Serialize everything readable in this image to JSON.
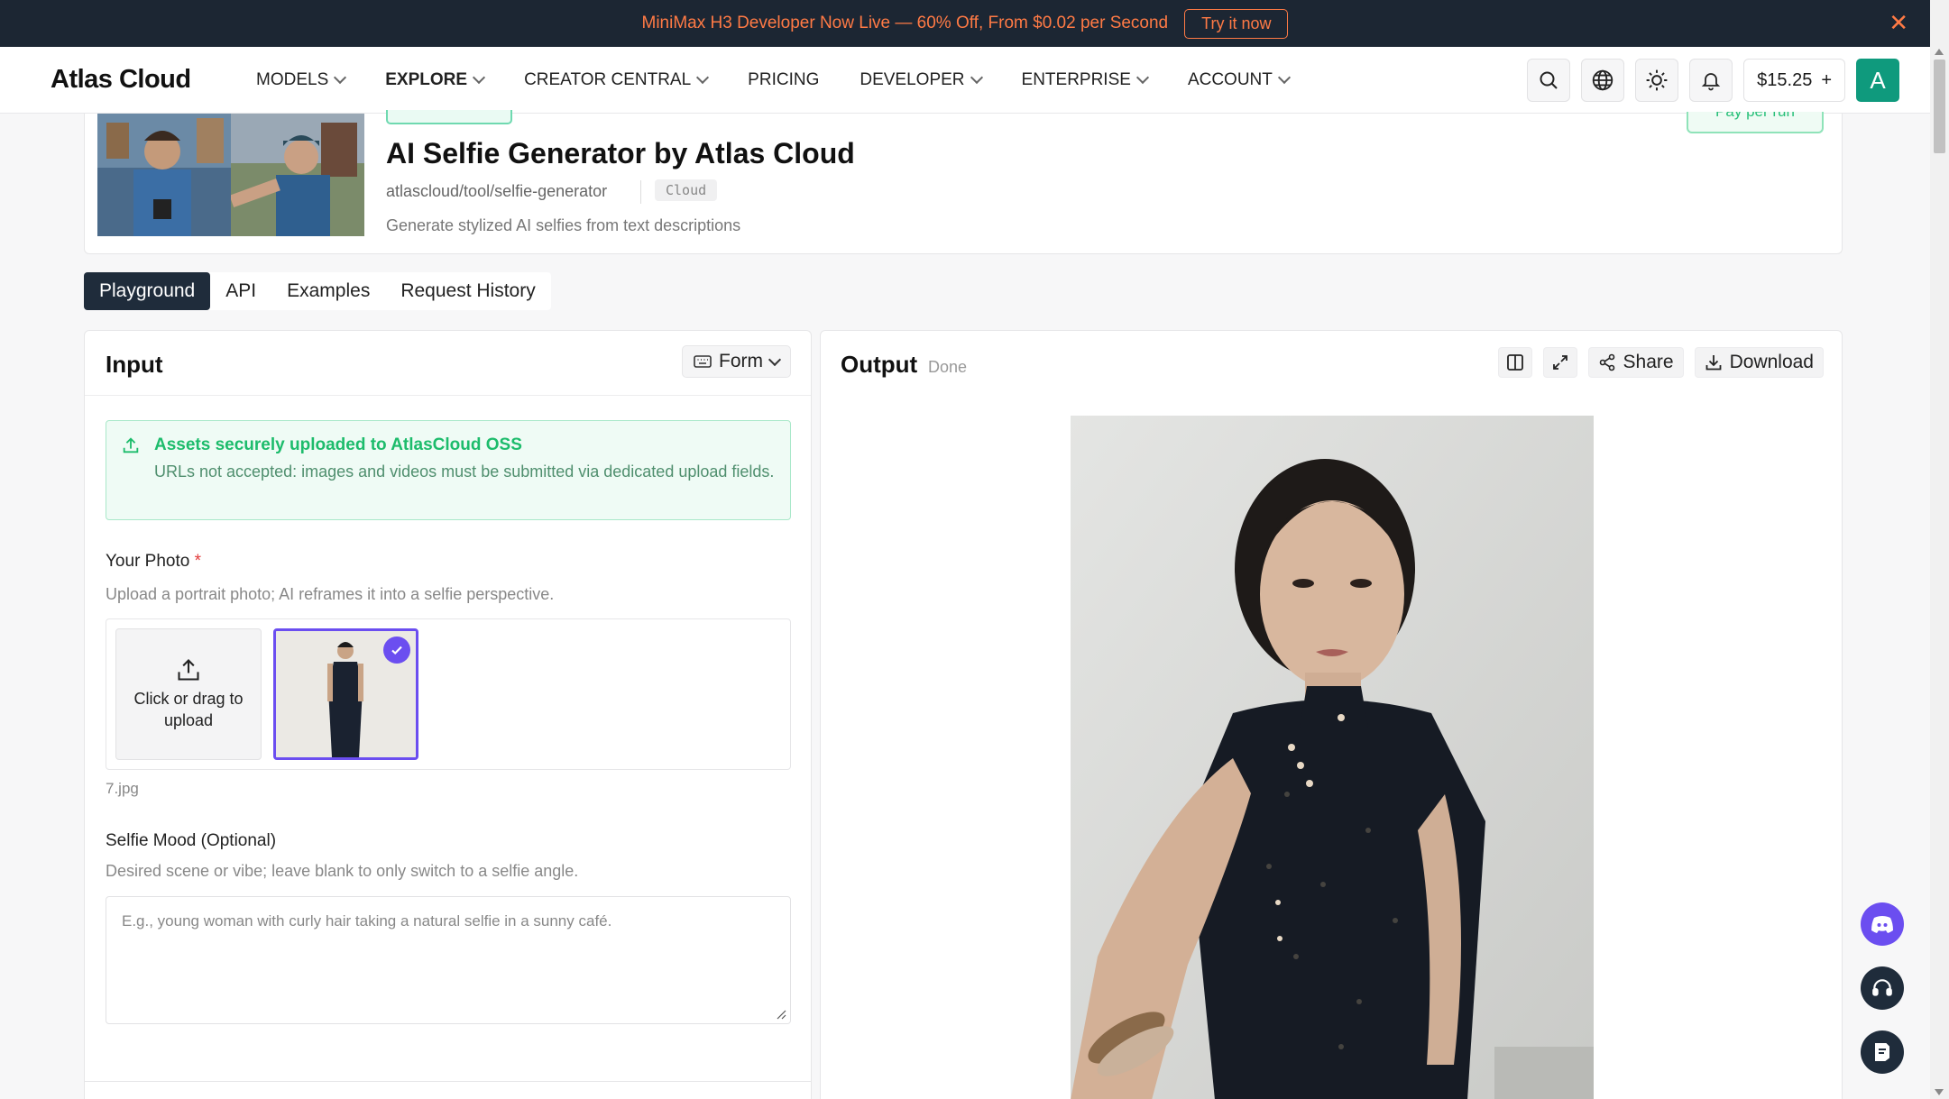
{
  "promo": {
    "text": "MiniMax H3 Developer Now Live — 60% Off, From $0.02 per Second",
    "cta": "Try it now",
    "close_icon": "close-icon",
    "color": "#ff7a45"
  },
  "nav": {
    "logo": "Atlas Cloud",
    "items": [
      {
        "label": "MODELS",
        "dropdown": true
      },
      {
        "label": "EXPLORE",
        "dropdown": true,
        "active": true
      },
      {
        "label": "CREATOR CENTRAL",
        "dropdown": true
      },
      {
        "label": "PRICING",
        "dropdown": false
      },
      {
        "label": "DEVELOPER",
        "dropdown": true
      },
      {
        "label": "ENTERPRISE",
        "dropdown": true
      },
      {
        "label": "ACCOUNT",
        "dropdown": true
      }
    ],
    "balance": "$15.25",
    "balance_add": "+",
    "avatar_letter": "A",
    "accent": "#0f9a7d"
  },
  "tool": {
    "title": "AI Selfie Generator by Atlas Cloud",
    "path": "atlascloud/tool/selfie-generator",
    "badge": "Cloud",
    "description": "Generate stylized AI selfies from text descriptions",
    "pay_badge": "Pay per run"
  },
  "tabs": [
    {
      "label": "Playground",
      "active": true
    },
    {
      "label": "API"
    },
    {
      "label": "Examples"
    },
    {
      "label": "Request History"
    }
  ],
  "input": {
    "title": "Input",
    "mode": "Form",
    "notice": {
      "title": "Assets securely uploaded to AtlasCloud OSS",
      "body": "URLs not accepted: images and videos must be submitted via dedicated upload fields."
    },
    "photo": {
      "label": "Your Photo",
      "required_mark": "*",
      "help": "Upload a portrait photo; AI reframes it into a selfie perspective.",
      "upload_text": "Click or drag to upload",
      "filename": "7.jpg"
    },
    "mood": {
      "label": "Selfie Mood (Optional)",
      "help": "Desired scene or vibe; leave blank to only switch to a selfie angle.",
      "placeholder": "E.g., young woman with curly hair taking a natural selfie in a sunny café."
    }
  },
  "output": {
    "title": "Output",
    "status": "Done",
    "share": "Share",
    "download": "Download"
  },
  "colors": {
    "dark": "#1f2c3b",
    "purple": "#6b4ef0",
    "success": "#1dbc6c"
  }
}
